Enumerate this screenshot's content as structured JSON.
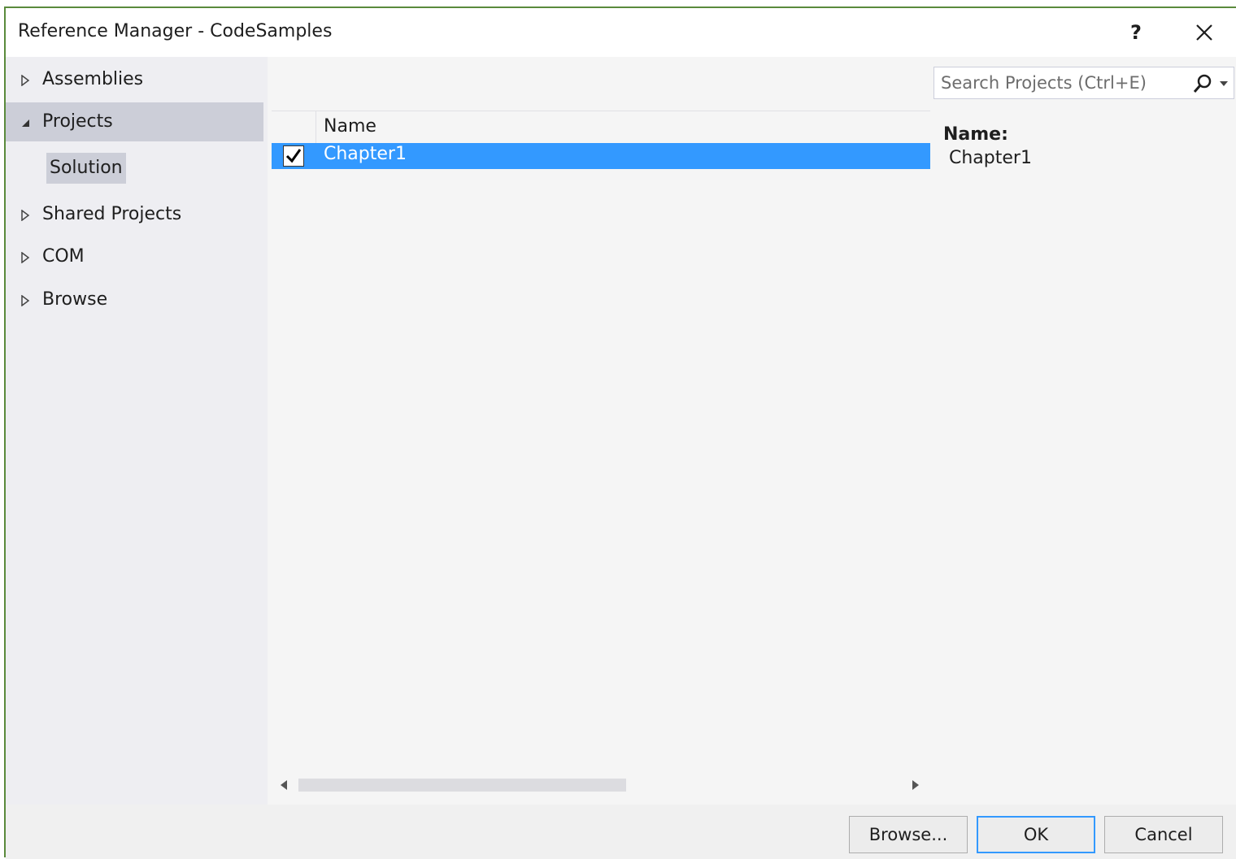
{
  "window": {
    "title": "Reference Manager - CodeSamples",
    "help_label": "?",
    "close_icon": "close-icon"
  },
  "nav": {
    "assemblies": "Assemblies",
    "projects": "Projects",
    "solution": "Solution",
    "shared_projects": "Shared Projects",
    "com": "COM",
    "browse": "Browse"
  },
  "search": {
    "placeholder": "Search Projects (Ctrl+E)",
    "value": ""
  },
  "list": {
    "columns": [
      "Name"
    ],
    "rows": [
      {
        "name": "Chapter1",
        "checked": true,
        "selected": true
      }
    ]
  },
  "details": {
    "name_label": "Name:",
    "name_value": "Chapter1"
  },
  "footer": {
    "browse": "Browse...",
    "ok": "OK",
    "cancel": "Cancel"
  },
  "colors": {
    "selection": "#3399ff",
    "nav_selected": "#ccced8",
    "accent_border": "#5a8a3c"
  }
}
